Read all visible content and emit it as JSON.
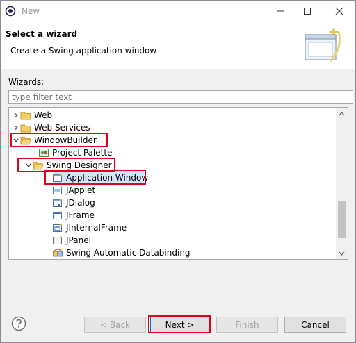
{
  "window": {
    "title": "New"
  },
  "header": {
    "title": "Select a wizard",
    "description": "Create a Swing application window"
  },
  "wizards": {
    "label": "Wizards:",
    "filter_placeholder": "type filter text",
    "items": [
      {
        "label": "Web",
        "state": "collapsed",
        "icon": "folder-icon"
      },
      {
        "label": "Web Services",
        "state": "collapsed",
        "icon": "folder-icon"
      },
      {
        "label": "WindowBuilder",
        "state": "expanded",
        "icon": "folder-open-icon"
      },
      {
        "label": "Project Palette",
        "icon": "palette-icon"
      },
      {
        "label": "Swing Designer",
        "state": "expanded",
        "icon": "folder-open-icon"
      },
      {
        "label": "Application Window",
        "icon": "window-icon",
        "selected": true
      },
      {
        "label": "JApplet",
        "icon": "applet-icon"
      },
      {
        "label": "JDialog",
        "icon": "dialog-icon"
      },
      {
        "label": "JFrame",
        "icon": "frame-icon"
      },
      {
        "label": "JInternalFrame",
        "icon": "internal-frame-icon"
      },
      {
        "label": "JPanel",
        "icon": "panel-icon"
      },
      {
        "label": "Swing Automatic Databinding",
        "icon": "databinding-icon"
      }
    ]
  },
  "buttons": {
    "back": "< Back",
    "next": "Next >",
    "finish": "Finish",
    "cancel": "Cancel"
  },
  "colors": {
    "highlight": "#e2001a",
    "selection": "#cce8ff",
    "default_button_border": "#0078d7"
  }
}
